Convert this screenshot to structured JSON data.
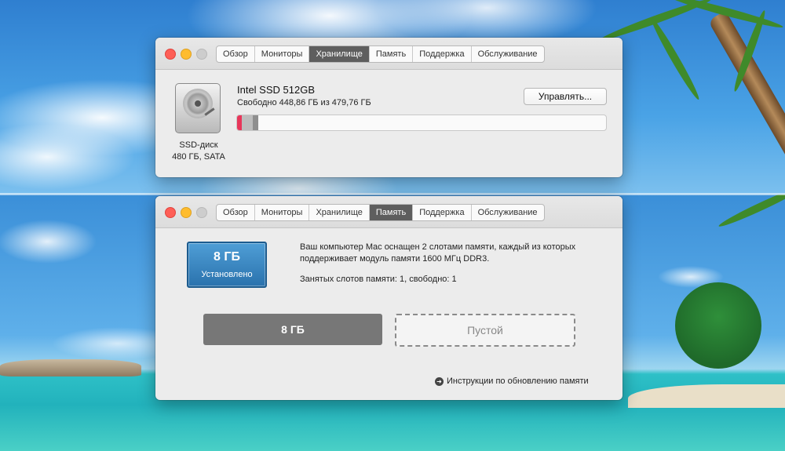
{
  "tabs": [
    "Обзор",
    "Мониторы",
    "Хранилище",
    "Память",
    "Поддержка",
    "Обслуживание"
  ],
  "storage_window": {
    "active_tab": "Хранилище",
    "disk_name": "Intel SSD 512GB",
    "free_text": "Свободно 448,86 ГБ из 479,76 ГБ",
    "manage_button": "Управлять...",
    "disk_type": "SSD-диск",
    "disk_desc": "480 ГБ, SATA",
    "storage_usage": {
      "total_gb": 479.76,
      "free_gb": 448.86,
      "segments": [
        {
          "color": "#e8365a",
          "fraction": 0.012
        },
        {
          "color": "#bdbdbd",
          "fraction": 0.03
        },
        {
          "color": "#8f8f8f",
          "fraction": 0.015
        }
      ]
    }
  },
  "memory_window": {
    "active_tab": "Память",
    "installed_amount": "8 ГБ",
    "installed_label": "Установлено",
    "info_line1": "Ваш компьютер Mac оснащен 2 слотами памяти, каждый из которых",
    "info_line2": "поддерживает модуль памяти 1600 МГц DDR3.",
    "slots_status": "Занятых слотов памяти: 1, свободно: 1",
    "slot1": "8 ГБ",
    "slot2": "Пустой",
    "help_link": "Инструкции по обновлению памяти"
  }
}
